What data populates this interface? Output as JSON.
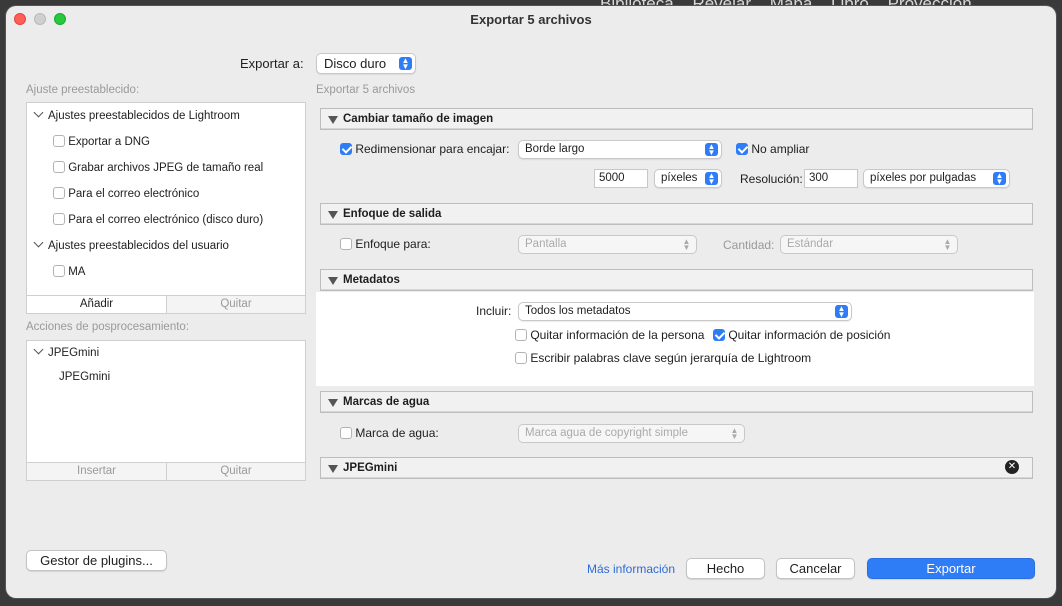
{
  "background_menu": [
    "Biblioteca",
    "Revelar",
    "Mapa",
    "Libro",
    "Proyección"
  ],
  "window": {
    "title": "Exportar 5 archivos"
  },
  "export_to": {
    "label": "Exportar a:",
    "value": "Disco duro"
  },
  "subtitle": "Exportar 5 archivos",
  "presets": {
    "label": "Ajuste preestablecido:",
    "groups": [
      {
        "name": "Ajustes preestablecidos de Lightroom",
        "items": [
          "Exportar a DNG",
          "Grabar archivos JPEG de tamaño real",
          "Para el correo electrónico",
          "Para el correo electrónico (disco duro)"
        ]
      },
      {
        "name": "Ajustes preestablecidos del usuario",
        "items": [
          "MA"
        ]
      }
    ],
    "add_label": "Añadir",
    "remove_label": "Quitar"
  },
  "post_actions": {
    "label": "Acciones de posprocesamiento:",
    "group": "JPEGmini",
    "item": "JPEGmini",
    "insert_label": "Insertar",
    "remove_label": "Quitar"
  },
  "sections": {
    "resize": {
      "title": "Cambiar tamaño de imagen",
      "fit_label": "Redimensionar para encajar:",
      "fit_value": "Borde largo",
      "no_enlarge_label": "No ampliar",
      "size_value": "5000",
      "size_unit": "píxeles",
      "resolution_label": "Resolución:",
      "resolution_value": "300",
      "resolution_unit": "píxeles por pulgadas"
    },
    "sharpen": {
      "title": "Enfoque de salida",
      "sharpen_label": "Enfoque para:",
      "sharpen_value": "Pantalla",
      "amount_label": "Cantidad:",
      "amount_value": "Estándar"
    },
    "metadata": {
      "title": "Metadatos",
      "include_label": "Incluir:",
      "include_value": "Todos los metadatos",
      "remove_person_label": "Quitar información de la persona",
      "remove_location_label": "Quitar información de posición",
      "keywords_label": "Escribir palabras clave según jerarquía de Lightroom"
    },
    "watermark": {
      "title": "Marcas de agua",
      "watermark_label": "Marca de agua:",
      "watermark_value": "Marca agua de copyright simple"
    },
    "jpegmini": {
      "title": "JPEGmini"
    }
  },
  "footer": {
    "plugin_manager": "Gestor de plugins...",
    "more_info": "Más información",
    "done": "Hecho",
    "cancel": "Cancelar",
    "export": "Exportar"
  },
  "colors": {
    "accent": "#2f7df6",
    "link": "#2f6bd6",
    "window": "#ececec"
  }
}
